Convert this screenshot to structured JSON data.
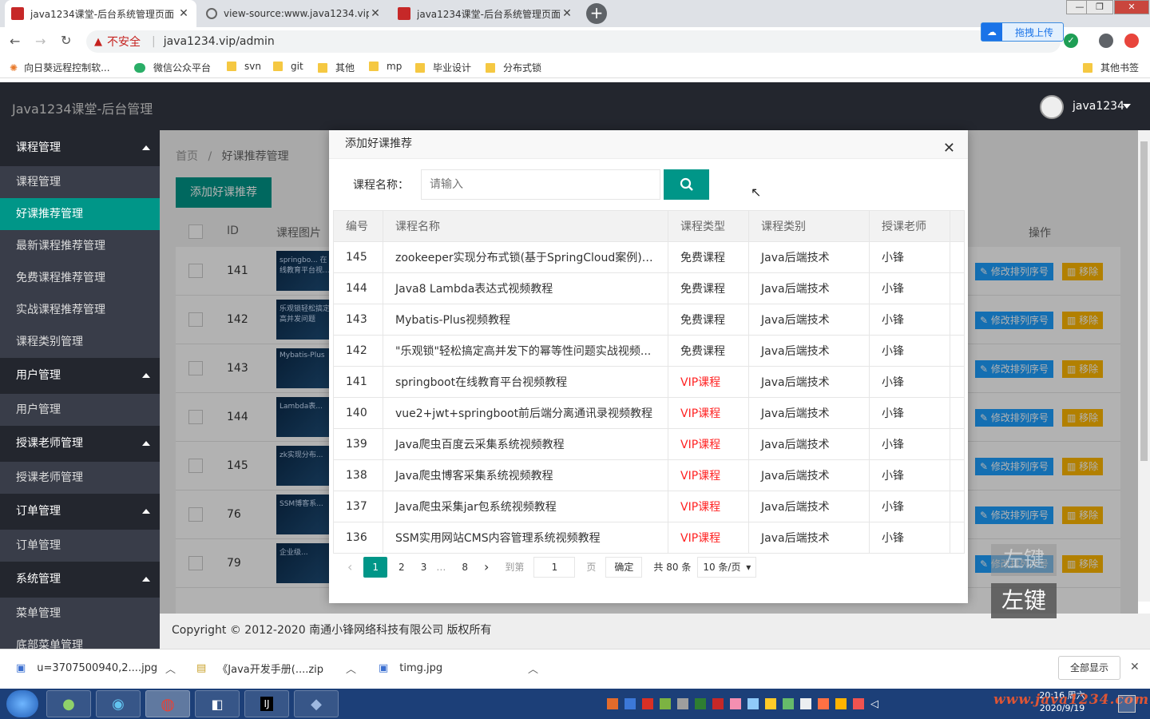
{
  "browser": {
    "tabs": [
      {
        "title": "java1234课堂-后台系统管理页面",
        "favicon": "java1234-icon",
        "active": true
      },
      {
        "title": "view-source:www.java1234.vip",
        "favicon": "globe-icon",
        "active": false
      },
      {
        "title": "java1234课堂-后台系统管理页面",
        "favicon": "java1234-icon",
        "active": false
      }
    ],
    "window_controls": [
      "—",
      "❐",
      "✕"
    ],
    "security_label": "不安全",
    "url": "java1234.vip/admin",
    "upload_pill": "拖拽上传",
    "bookmarks": [
      {
        "label": "向日葵远程控制软...",
        "icon": "sunflower-icon"
      },
      {
        "label": "微信公众平台",
        "icon": "wechat-icon"
      },
      {
        "label": "svn",
        "icon": "folder-icon"
      },
      {
        "label": "git",
        "icon": "folder-icon"
      },
      {
        "label": "其他",
        "icon": "folder-icon"
      },
      {
        "label": "mp",
        "icon": "folder-icon"
      },
      {
        "label": "毕业设计",
        "icon": "folder-icon"
      },
      {
        "label": "分布式锁",
        "icon": "folder-icon"
      }
    ],
    "other_bookmarks": "其他书签"
  },
  "app": {
    "logo": "Java1234课堂-后台管理",
    "user": "java1234",
    "sidebar": [
      {
        "group": "课程管理",
        "items": [
          "课程管理",
          "好课推荐管理",
          "最新课程推荐管理",
          "免费课程推荐管理",
          "实战课程推荐管理",
          "课程类别管理"
        ]
      },
      {
        "group": "用户管理",
        "items": [
          "用户管理"
        ]
      },
      {
        "group": "授课老师管理",
        "items": [
          "授课老师管理"
        ]
      },
      {
        "group": "订单管理",
        "items": [
          "订单管理"
        ]
      },
      {
        "group": "系统管理",
        "items": [
          "菜单管理",
          "底部菜单管理"
        ]
      }
    ],
    "selected_item": "好课推荐管理",
    "breadcrumb": [
      "首页",
      "好课推荐管理"
    ],
    "add_button": "添加好课推荐",
    "table": {
      "headers": [
        "ID",
        "课程图片",
        "操作"
      ],
      "rows": [
        {
          "id": "141",
          "thumb": "springbo... 在线教育平台视..."
        },
        {
          "id": "142",
          "thumb": "乐观锁轻松搞定高并发问题"
        },
        {
          "id": "143",
          "thumb": "Mybatis-Plus"
        },
        {
          "id": "144",
          "thumb": "Lambda表..."
        },
        {
          "id": "145",
          "thumb": "zk实现分布..."
        },
        {
          "id": "76",
          "thumb": "SSM博客系..."
        },
        {
          "id": "79",
          "thumb": "企业级..."
        }
      ],
      "edit_label": "修改排列序号",
      "remove_label": "移除"
    },
    "footer": "Copyright © 2012-2020 南通小锋网络科技有限公司 版权所有"
  },
  "modal": {
    "title": "添加好课推荐",
    "search_label": "课程名称：",
    "search_placeholder": "请输入",
    "columns": [
      "编号",
      "课程名称",
      "课程类型",
      "课程类别",
      "授课老师"
    ],
    "rows": [
      {
        "id": "145",
        "name": "zookeeper实现分布式锁(基于SpringCloud案例)视...",
        "type": "免费课程",
        "category": "Java后端技术",
        "teacher": "小锋"
      },
      {
        "id": "144",
        "name": "Java8 Lambda表达式视频教程",
        "type": "免费课程",
        "category": "Java后端技术",
        "teacher": "小锋"
      },
      {
        "id": "143",
        "name": "Mybatis-Plus视频教程",
        "type": "免费课程",
        "category": "Java后端技术",
        "teacher": "小锋"
      },
      {
        "id": "142",
        "name": "\"乐观锁\"轻松搞定高并发下的幂等性问题实战视频...",
        "type": "免费课程",
        "category": "Java后端技术",
        "teacher": "小锋"
      },
      {
        "id": "141",
        "name": "springboot在线教育平台视频教程",
        "type": "VIP课程",
        "category": "Java后端技术",
        "teacher": "小锋"
      },
      {
        "id": "140",
        "name": "vue2+jwt+springboot前后端分离通讯录视频教程",
        "type": "VIP课程",
        "category": "Java后端技术",
        "teacher": "小锋"
      },
      {
        "id": "139",
        "name": "Java爬虫百度云采集系统视频教程",
        "type": "VIP课程",
        "category": "Java后端技术",
        "teacher": "小锋"
      },
      {
        "id": "138",
        "name": "Java爬虫博客采集系统视频教程",
        "type": "VIP课程",
        "category": "Java后端技术",
        "teacher": "小锋"
      },
      {
        "id": "137",
        "name": "Java爬虫采集jar包系统视频教程",
        "type": "VIP课程",
        "category": "Java后端技术",
        "teacher": "小锋"
      },
      {
        "id": "136",
        "name": "SSM实用网站CMS内容管理系统视频教程",
        "type": "VIP课程",
        "category": "Java后端技术",
        "teacher": "小锋"
      }
    ],
    "pager": {
      "pages": [
        "1",
        "2",
        "3",
        "…",
        "8"
      ],
      "current": "1",
      "goto_label": "到第",
      "goto_value": "1",
      "page_unit": "页",
      "confirm": "确定",
      "total": "共 80 条",
      "per_page": "10 条/页"
    }
  },
  "overlay_hint": {
    "ghost": "左键",
    "label": "左键"
  },
  "downloads": {
    "items": [
      "u=3707500940,2....jpg",
      "《Java开发手册(....zip",
      "timg.jpg"
    ],
    "show_all": "全部显示"
  },
  "taskbar": {
    "clock_time": "20:16 周六",
    "clock_date": "2020/9/19",
    "watermark": "www.java1234.com"
  },
  "colors": {
    "accent": "#009688",
    "vip": "#ff2222",
    "header_bg": "#23262e",
    "sidebar_bg": "#393d49",
    "edit_btn": "#1e9fff",
    "remove_btn": "#ffb800"
  }
}
